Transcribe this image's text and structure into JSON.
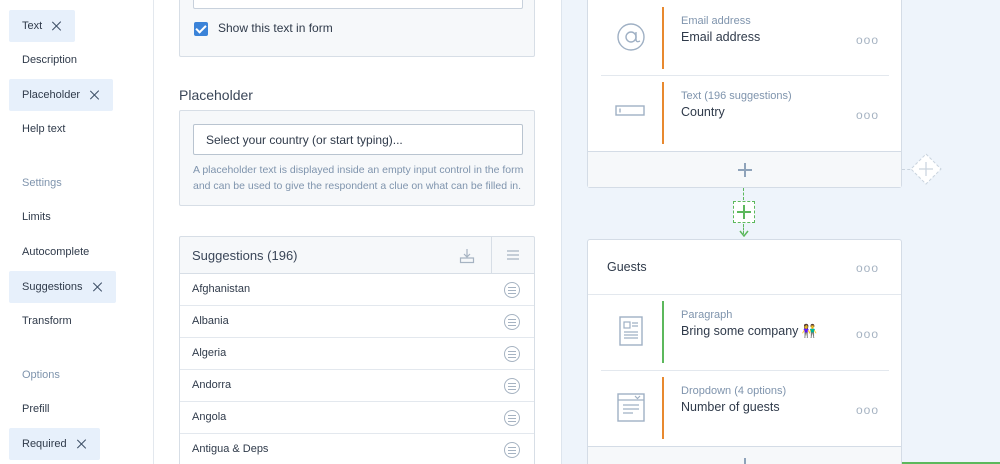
{
  "sidebar": {
    "items": [
      {
        "label": "Text",
        "active": true
      },
      {
        "label": "Description",
        "active": false
      },
      {
        "label": "Placeholder",
        "active": true
      },
      {
        "label": "Help text",
        "active": false
      },
      {
        "label": "Limits",
        "active": false
      },
      {
        "label": "Autocomplete",
        "active": false
      },
      {
        "label": "Suggestions",
        "active": true
      },
      {
        "label": "Transform",
        "active": false
      },
      {
        "label": "Prefill",
        "active": false
      },
      {
        "label": "Required",
        "active": true
      }
    ],
    "sections": [
      "Settings",
      "Options"
    ]
  },
  "text_card": {
    "checkbox_label": "Show this text in form",
    "checked": true
  },
  "placeholder": {
    "heading": "Placeholder",
    "input_value": "Select your country (or start typing)...",
    "help": "A placeholder text is displayed inside an empty input control in the form and can be used to give the respondent a clue on what can be filled in."
  },
  "suggestions": {
    "title": "Suggestions (196)",
    "rows": [
      "Afghanistan",
      "Albania",
      "Algeria",
      "Andorra",
      "Angola",
      "Antigua & Deps"
    ]
  },
  "canvas": {
    "block1": {
      "questions": [
        {
          "type": "Email address",
          "name": "Email address",
          "icon": "at-sign-icon",
          "bar_color": "#e8892f"
        },
        {
          "type": "Text (196 suggestions)",
          "name": "Country",
          "icon": "text-field-icon",
          "bar_color": "#e8892f"
        }
      ]
    },
    "block2": {
      "title": "Guests",
      "questions": [
        {
          "type": "Paragraph",
          "name": "Bring some company 👫",
          "icon": "paragraph-icon",
          "bar_color": "#5cb85c"
        },
        {
          "type": "Dropdown (4 options)",
          "name": "Number of guests",
          "icon": "dropdown-icon",
          "bar_color": "#e8892f"
        }
      ]
    },
    "dots": "ooo"
  }
}
